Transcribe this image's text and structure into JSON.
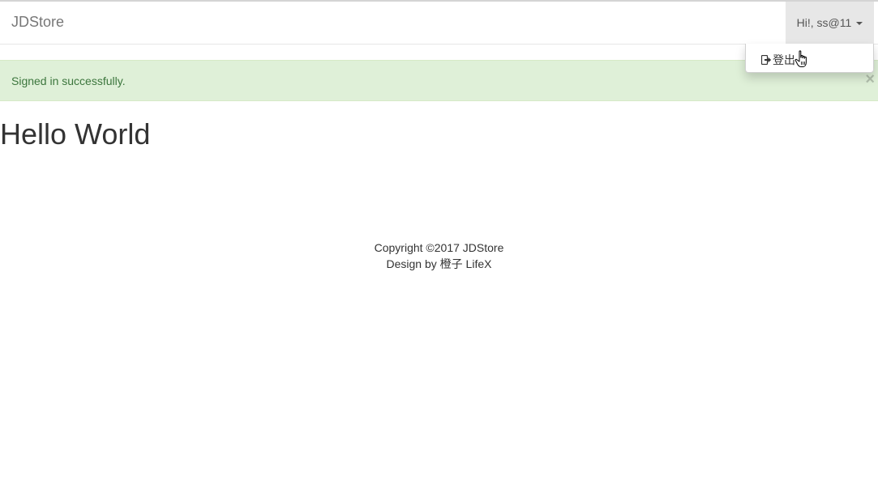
{
  "navbar": {
    "brand": "JDStore",
    "user_greeting": "Hi!, ss@11"
  },
  "dropdown": {
    "items": [
      {
        "label": "登出",
        "icon": "logout-icon"
      }
    ]
  },
  "alert": {
    "message": "Signed in successfully.",
    "close_label": "×"
  },
  "main": {
    "heading": "Hello World"
  },
  "footer": {
    "copyright": "Copyright ©2017 JDStore",
    "credit": "Design by 橙子 LifeX"
  },
  "colors": {
    "alert_bg": "#dff0d8",
    "alert_text": "#3c763d",
    "toggle_bg": "#e7e7e7"
  }
}
